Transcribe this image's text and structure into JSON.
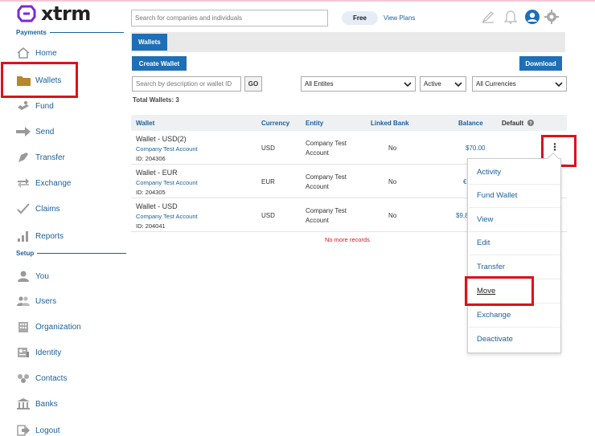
{
  "app": {
    "brand": "xtrm"
  },
  "sidebar": {
    "payments_head": "Payments",
    "setup_head": "Setup",
    "payments": [
      {
        "label": "Home",
        "icon": "home-icon"
      },
      {
        "label": "Wallets",
        "icon": "folder-icon"
      },
      {
        "label": "Fund",
        "icon": "fund-icon"
      },
      {
        "label": "Send",
        "icon": "send-icon"
      },
      {
        "label": "Transfer",
        "icon": "transfer-icon"
      },
      {
        "label": "Exchange",
        "icon": "exchange-icon"
      },
      {
        "label": "Claims",
        "icon": "check-icon"
      },
      {
        "label": "Reports",
        "icon": "bar-chart-icon"
      }
    ],
    "setup": [
      {
        "label": "You",
        "icon": "user-icon"
      },
      {
        "label": "Users",
        "icon": "users-icon"
      },
      {
        "label": "Organization",
        "icon": "building-icon"
      },
      {
        "label": "Identity",
        "icon": "id-card-icon"
      },
      {
        "label": "Contacts",
        "icon": "contacts-icon"
      },
      {
        "label": "Banks",
        "icon": "bank-icon"
      },
      {
        "label": "Logout",
        "icon": "logout-icon"
      }
    ]
  },
  "header": {
    "search_placeholder": "Search for companies and individuals",
    "plan": "Free",
    "view_plans": "View Plans"
  },
  "tabs": {
    "wallets": "Wallets"
  },
  "toolbar": {
    "create_wallet": "Create Wallet",
    "download": "Download",
    "search_placeholder": "Search by description or wallet ID",
    "go": "GO",
    "entity_select": "All Entites",
    "status_select": "Active",
    "currency_select": "All Currencies",
    "total": "Total Wallets: 3"
  },
  "table": {
    "headers": {
      "wallet": "Wallet",
      "currency": "Currency",
      "entity": "Entity",
      "linked_bank": "Linked Bank",
      "balance": "Balance",
      "default": "Default"
    },
    "rows": [
      {
        "name": "Wallet - USD(2)",
        "account": "Company Test Account",
        "id": "ID: 204306",
        "currency": "USD",
        "entity_l1": "Company Test",
        "entity_l2": "Account",
        "linked": "No",
        "balance": "$70.00"
      },
      {
        "name": "Wallet - EUR",
        "account": "Company Test Account",
        "id": "ID: 204305",
        "currency": "EUR",
        "entity_l1": "Company Test",
        "entity_l2": "Account",
        "linked": "No",
        "balance": "€"
      },
      {
        "name": "Wallet - USD",
        "account": "Company Test Account",
        "id": "ID: 204041",
        "currency": "USD",
        "entity_l1": "Company Test",
        "entity_l2": "Account",
        "linked": "No",
        "balance": "$9,8"
      }
    ],
    "no_more": "No more records"
  },
  "menu": {
    "items": [
      "Activity",
      "Fund Wallet",
      "View",
      "Edit",
      "Transfer",
      "Move",
      "Exchange",
      "Deactivate"
    ]
  },
  "colors": {
    "accent": "#1e6fb5",
    "link": "#1b5f9c",
    "highlight": "#d8141a",
    "brand": "#7a2bd6"
  }
}
